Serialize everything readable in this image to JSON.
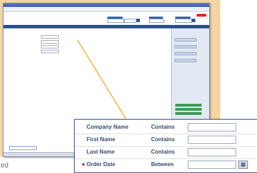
{
  "form_rows": [
    {
      "required": false,
      "label": "Company Name",
      "operator": "Contains"
    },
    {
      "required": false,
      "label": "First Name",
      "operator": "Contains"
    },
    {
      "required": false,
      "label": "Last Name",
      "operator": "Contains"
    },
    {
      "required": true,
      "label": "Order Date",
      "operator": "Between"
    }
  ],
  "required_marker": "•",
  "calendar_icon": "calendar-icon",
  "footer_caption": "ed",
  "colors": {
    "accent_blue": "#2b4e93",
    "label_text": "#3a4b6e",
    "required_marker": "#cc2222",
    "background_panel": "#f4d5a3",
    "zoom_line": "#f0a21a"
  }
}
